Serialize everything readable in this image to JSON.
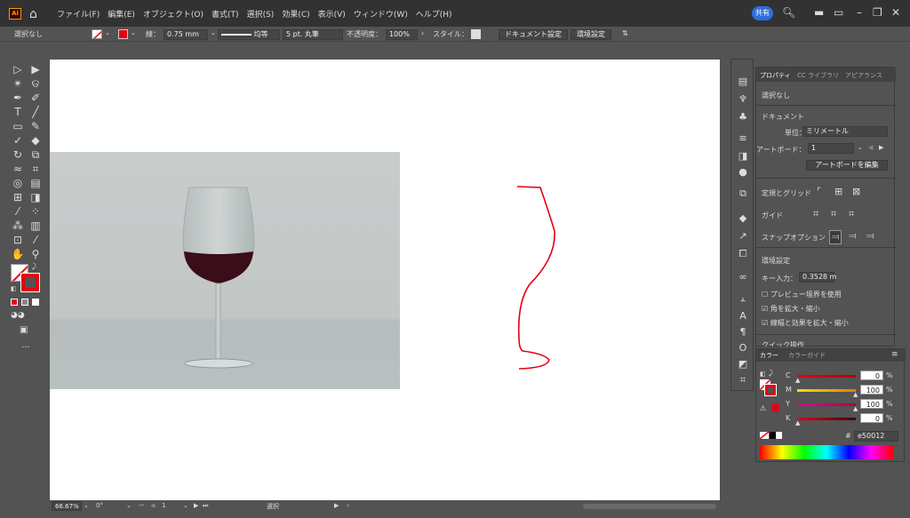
{
  "menubar": {
    "logo": "Ai",
    "items": [
      "ファイル(F)",
      "編集(E)",
      "オブジェクト(O)",
      "書式(T)",
      "選択(S)",
      "効果(C)",
      "表示(V)",
      "ウィンドウ(W)",
      "ヘルプ(H)"
    ],
    "share": "共有"
  },
  "controlbar": {
    "selection": "選択なし",
    "stroke_label": "線：",
    "stroke_value": "0.75 mm",
    "profile": "均等",
    "brush": "5 pt. 丸筆",
    "opacity_label": "不透明度：",
    "opacity_value": "100%",
    "style_label": "スタイル：",
    "doc_settings": "ドキュメント設定",
    "prefs": "環境設定"
  },
  "properties": {
    "tabs": [
      "プロパティ",
      "CC ライブラリ",
      "アピアランス"
    ],
    "no_selection": "選択なし",
    "document": "ドキュメント",
    "unit_label": "単位：",
    "unit_value": "ミリメートル",
    "artboard_label": "アートボード：",
    "artboard_value": "1",
    "artboard_edit": "アートボードを編集",
    "rulers_grids": "定規とグリッド",
    "guides": "ガイド",
    "snap": "スナップオプション",
    "env": "環境設定",
    "key_input_label": "キー入力：",
    "key_input_value": "0.3528 m",
    "preview_bounds": "プレビュー境界を使用",
    "scale_corners": "角を拡大・縮小",
    "scale_strokes": "線幅と効果を拡大・縮小",
    "quick_actions": "クイック操作"
  },
  "color_panel": {
    "tabs": [
      "カラー",
      "カラーガイド"
    ],
    "channels": [
      {
        "label": "C",
        "value": "0",
        "unit": "%",
        "color": "#c0392b",
        "level": 0
      },
      {
        "label": "M",
        "value": "100",
        "unit": "%",
        "color": "#d4c400",
        "level": 100
      },
      {
        "label": "Y",
        "value": "100",
        "unit": "%",
        "color": "#c020a0",
        "level": 100
      },
      {
        "label": "K",
        "value": "0",
        "unit": "%",
        "color": "#b03020",
        "level": 0
      }
    ],
    "hex_prefix": "#",
    "hex": "e50012",
    "stroke_color": "#e50012"
  },
  "statusbar": {
    "zoom": "66.67%",
    "rotation": "0°",
    "artboard": "1",
    "tool": "選択"
  },
  "icons": [
    "home-icon",
    "search-icon",
    "selection-tool-icon",
    "direct-selection-tool-icon",
    "pen-tool-icon",
    "type-tool-icon",
    "line-tool-icon",
    "rectangle-tool-icon",
    "paintbrush-tool-icon",
    "hand-tool-icon",
    "zoom-tool-icon"
  ]
}
